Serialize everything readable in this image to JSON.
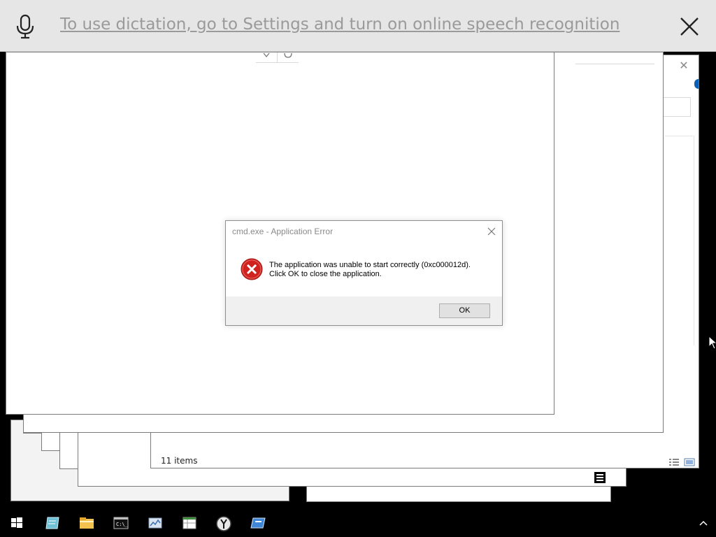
{
  "dictation": {
    "message": "To use dictation, go to Settings and turn on online speech recognition"
  },
  "explorer": {
    "status_items": "11 items"
  },
  "dialog": {
    "title": "cmd.exe - Application Error",
    "message_line1": "The application was unable to start correctly (0xc000012d).",
    "message_line2": "Click OK to close the application.",
    "ok_label": "OK"
  },
  "taskbar": {
    "items": [
      {
        "icon": "windows-start-icon"
      },
      {
        "icon": "notepad-icon"
      },
      {
        "icon": "file-explorer-icon"
      },
      {
        "icon": "command-prompt-icon"
      },
      {
        "icon": "control-panel-icon"
      },
      {
        "icon": "spreadsheet-icon"
      },
      {
        "icon": "clock-icon"
      },
      {
        "icon": "app-icon"
      }
    ],
    "tray_icon": "chevron-up-icon"
  },
  "colors": {
    "error_red": "#d0231f",
    "dictation_text": "#9a9a9a",
    "accent_blue": "#0b5fb5"
  }
}
